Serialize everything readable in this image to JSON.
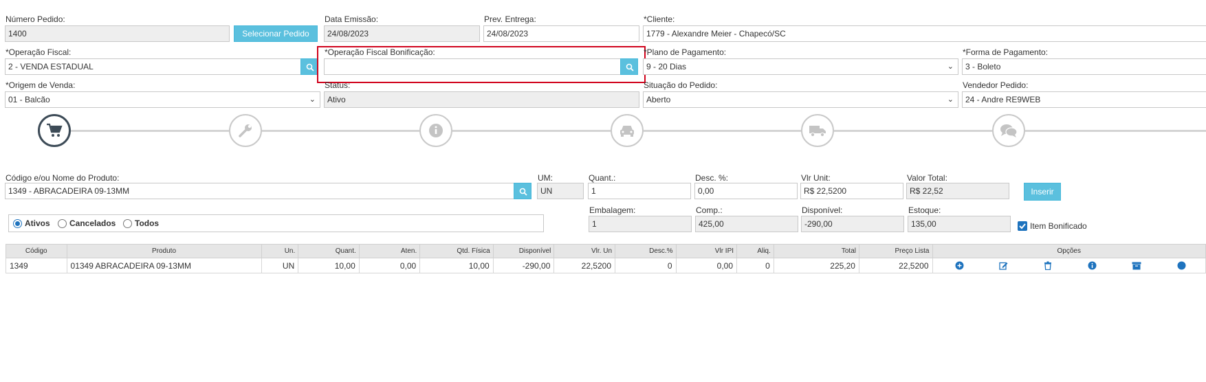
{
  "header": {
    "numero_pedido": {
      "label": "Número Pedido:",
      "value": "1400"
    },
    "selecionar_pedido": "Selecionar Pedido",
    "data_emissao": {
      "label": "Data Emissão:",
      "value": "24/08/2023"
    },
    "prev_entrega": {
      "label": "Prev. Entrega:",
      "value": "24/08/2023"
    },
    "cliente": {
      "label": "*Cliente:",
      "value": "1779 - Alexandre Meier - Chapecó/SC"
    },
    "operacao_fiscal": {
      "label": "*Operação Fiscal:",
      "value": "2 - VENDA ESTADUAL"
    },
    "operacao_bonificacao": {
      "label": "*Operação Fiscal Bonificação:",
      "value": ""
    },
    "plano_pagamento": {
      "label": "*Plano de Pagamento:",
      "value": "9 - 20 Dias"
    },
    "forma_pagamento": {
      "label": "*Forma de Pagamento:",
      "value": "3 - Boleto"
    },
    "origem_venda": {
      "label": "*Origem de Venda:",
      "value": "01 - Balcão"
    },
    "status": {
      "label": "Status:",
      "value": "Ativo"
    },
    "situacao_pedido": {
      "label": "Situação do Pedido:",
      "value": "Aberto"
    },
    "vendedor_pedido": {
      "label": "Vendedor Pedido:",
      "value": "24 - Andre RE9WEB"
    }
  },
  "steps": [
    "cart-icon",
    "wrench-icon",
    "info-icon",
    "car-icon",
    "truck-icon",
    "chat-icon"
  ],
  "product": {
    "codigo": {
      "label": "Código e/ou Nome do Produto:",
      "value": "1349 - ABRACADEIRA 09-13MM"
    },
    "um": {
      "label": "UM:",
      "value": "UN"
    },
    "quant": {
      "label": "Quant.:",
      "value": "1"
    },
    "desc": {
      "label": "Desc. %:",
      "value": "0,00"
    },
    "vlr_unit": {
      "label": "Vlr Unit:",
      "value": "R$ 22,5200"
    },
    "valor_total": {
      "label": "Valor Total:",
      "value": "R$ 22,52"
    },
    "inserir": "Inserir",
    "embalagem": {
      "label": "Embalagem:",
      "value": "1"
    },
    "comp": {
      "label": "Comp.:",
      "value": "425,00"
    },
    "disponivel": {
      "label": "Disponível:",
      "value": "-290,00"
    },
    "estoque": {
      "label": "Estoque:",
      "value": "135,00"
    },
    "item_bonificado": "Item Bonificado"
  },
  "filter": {
    "ativos": "Ativos",
    "cancelados": "Cancelados",
    "todos": "Todos",
    "selected": "Ativos"
  },
  "table": {
    "headers": [
      "Código",
      "Produto",
      "Un.",
      "Quant.",
      "Aten.",
      "Qtd. Física",
      "Disponível",
      "Vlr. Un",
      "Desc.%",
      "Vlr IPI",
      "Aliq.",
      "Total",
      "Preço Lista",
      "Opções"
    ],
    "rows": [
      [
        "1349",
        "01349 ABRACADEIRA 09-13MM",
        "UN",
        "10,00",
        "0,00",
        "10,00",
        "-290,00",
        "22,5200",
        "0",
        "0,00",
        "0",
        "225,20",
        "22,5200"
      ]
    ],
    "option_icons": [
      "plus-circle-icon",
      "edit-icon",
      "trash-icon",
      "info-circle-icon",
      "archive-icon",
      "more-icon"
    ]
  },
  "colors": {
    "accent": "#5bc0de",
    "highlight": "#d0021b",
    "primary": "#1e73be"
  }
}
